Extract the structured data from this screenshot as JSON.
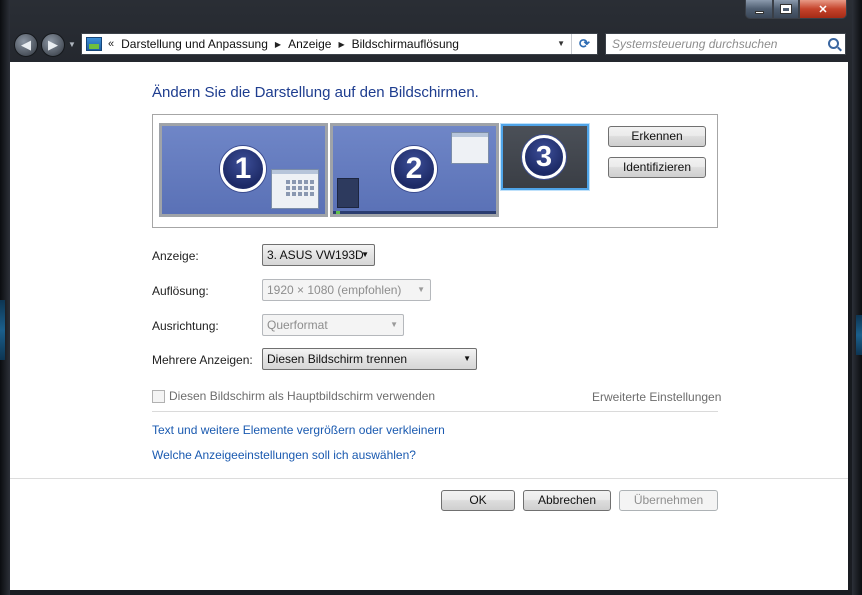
{
  "window": {
    "caption": {
      "minimize_icon": "minimize-icon",
      "maximize_icon": "maximize-icon",
      "close_icon": "close-icon",
      "close_glyph": "✕"
    }
  },
  "nav": {
    "back_glyph": "◀",
    "forward_glyph": "▶",
    "breadcrumb_overflow": "«",
    "breadcrumbs": [
      "Darstellung und Anpassung",
      "Anzeige",
      "Bildschirmauflösung"
    ],
    "search_placeholder": "Systemsteuerung durchsuchen"
  },
  "page": {
    "title": "Ändern Sie die Darstellung auf den Bildschirmen.",
    "monitors": [
      {
        "number": "1",
        "selected": false
      },
      {
        "number": "2",
        "selected": false
      },
      {
        "number": "3",
        "selected": true
      }
    ],
    "buttons": {
      "detect": "Erkennen",
      "identify": "Identifizieren"
    },
    "fields": {
      "display": {
        "label": "Anzeige:",
        "value": "3. ASUS VW193D"
      },
      "resolution": {
        "label": "Auflösung:",
        "value": "1920 × 1080 (empfohlen)"
      },
      "orientation": {
        "label": "Ausrichtung:",
        "value": "Querformat"
      },
      "multiple": {
        "label": "Mehrere Anzeigen:",
        "value": "Diesen Bildschirm trennen"
      }
    },
    "primary_checkbox": {
      "label": "Diesen Bildschirm als Hauptbildschirm verwenden",
      "checked": false
    },
    "advanced_link": "Erweiterte Einstellungen",
    "links": [
      "Text und weitere Elemente vergrößern oder verkleinern",
      "Welche Anzeigeeinstellungen soll ich auswählen?"
    ],
    "footer": {
      "ok": "OK",
      "cancel": "Abbrechen",
      "apply": "Übernehmen"
    }
  },
  "colors": {
    "title_blue": "#1e3d8f",
    "link_blue": "#1a5ab0",
    "monitor_blue": "#5a71b6",
    "selected_border": "#4fa4e8"
  }
}
